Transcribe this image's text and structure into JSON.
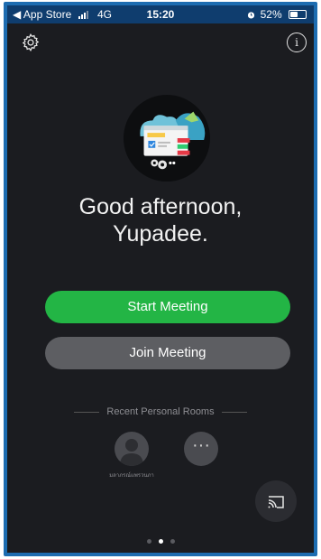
{
  "status_bar": {
    "back_app": "◀ App Store",
    "network": "4G",
    "time": "15:20",
    "battery": "52%",
    "battery_level": 0.52
  },
  "header": {
    "settings_icon": "gear-icon",
    "info_icon": "info-icon",
    "info_glyph": "i"
  },
  "greeting": {
    "line1": "Good afternoon,",
    "line2": "Yupadee."
  },
  "actions": {
    "start_label": "Start Meeting",
    "join_label": "Join Meeting"
  },
  "recent": {
    "title": "Recent Personal Rooms",
    "rooms": [
      {
        "name": "มลาภรณ์แพรวนภา",
        "icon": "avatar-icon"
      },
      {
        "name": "",
        "icon": "more-icon",
        "glyph": "···"
      }
    ]
  },
  "cast_icon": "screen-share-icon",
  "page_indicator": {
    "count": 3,
    "active": 1
  },
  "colors": {
    "background": "#1b1c20",
    "start": "#23b545",
    "join": "#5d5e62",
    "status_bar": "#0f3d6e"
  }
}
